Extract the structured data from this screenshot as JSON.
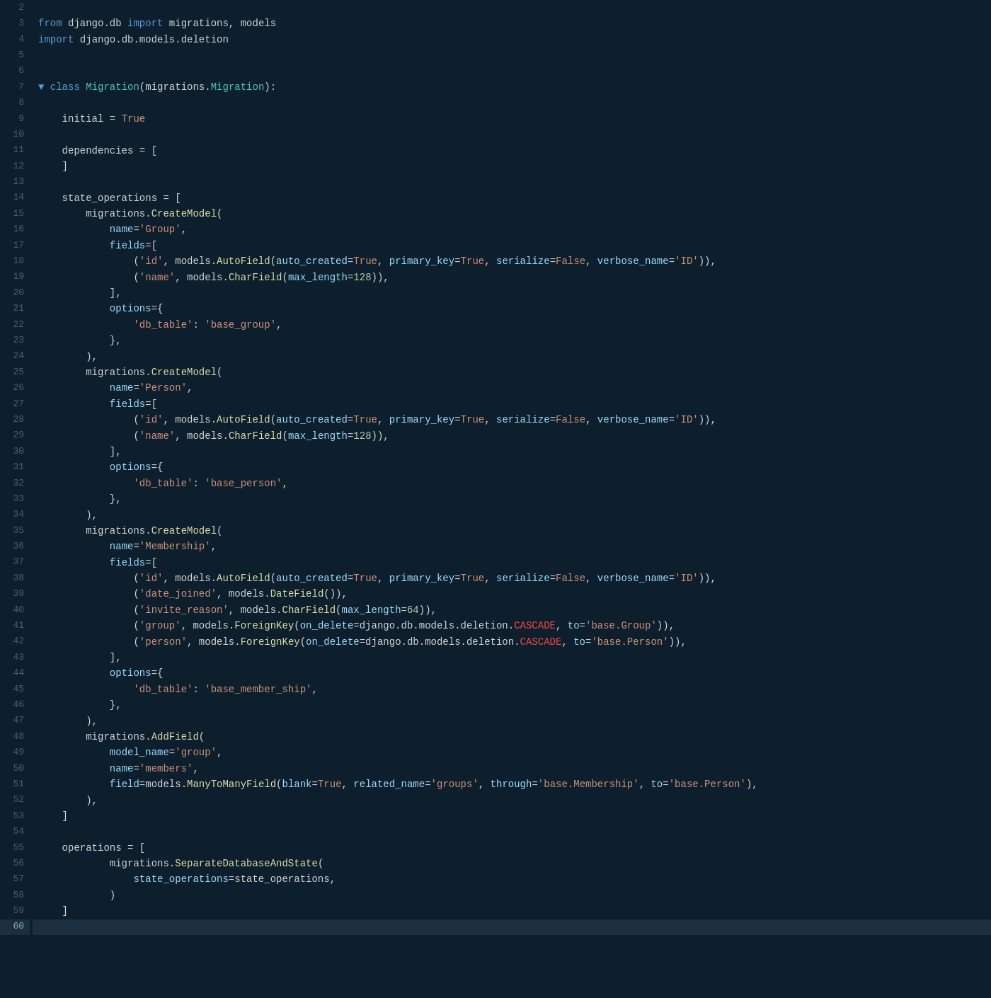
{
  "editor": {
    "background": "#0d1f2d",
    "active_line": 60
  },
  "lines": [
    {
      "num": 2,
      "content": "",
      "tokens": []
    },
    {
      "num": 3,
      "content": "from django.db import migrations, models",
      "active": false
    },
    {
      "num": 4,
      "content": "import django.db.models.deletion",
      "active": false
    },
    {
      "num": 5,
      "content": "",
      "tokens": []
    },
    {
      "num": 6,
      "content": "",
      "tokens": []
    },
    {
      "num": 7,
      "content": "▼ class Migration(migrations.Migration):",
      "active": false
    },
    {
      "num": 8,
      "content": "",
      "tokens": []
    },
    {
      "num": 9,
      "content": "    initial = True",
      "active": false
    },
    {
      "num": 10,
      "content": "",
      "tokens": []
    },
    {
      "num": 11,
      "content": "    dependencies = [",
      "active": false
    },
    {
      "num": 12,
      "content": "    ]",
      "active": false
    },
    {
      "num": 13,
      "content": "",
      "tokens": []
    },
    {
      "num": 14,
      "content": "    state_operations = [",
      "active": false
    },
    {
      "num": 15,
      "content": "        migrations.CreateModel(",
      "active": false
    },
    {
      "num": 16,
      "content": "            name='Group',",
      "active": false
    },
    {
      "num": 17,
      "content": "            fields=[",
      "active": false
    },
    {
      "num": 18,
      "content": "                ('id', models.AutoField(auto_created=True, primary_key=True, serialize=False, verbose_name='ID')),",
      "active": false
    },
    {
      "num": 19,
      "content": "                ('name', models.CharField(max_length=128)),",
      "active": false
    },
    {
      "num": 20,
      "content": "            ],",
      "active": false
    },
    {
      "num": 21,
      "content": "            options={",
      "active": false
    },
    {
      "num": 22,
      "content": "                'db_table': 'base_group',",
      "active": false
    },
    {
      "num": 23,
      "content": "            },",
      "active": false
    },
    {
      "num": 24,
      "content": "        ),",
      "active": false
    },
    {
      "num": 25,
      "content": "        migrations.CreateModel(",
      "active": false
    },
    {
      "num": 26,
      "content": "            name='Person',",
      "active": false
    },
    {
      "num": 27,
      "content": "            fields=[",
      "active": false
    },
    {
      "num": 28,
      "content": "                ('id', models.AutoField(auto_created=True, primary_key=True, serialize=False, verbose_name='ID')),",
      "active": false
    },
    {
      "num": 29,
      "content": "                ('name', models.CharField(max_length=128)),",
      "active": false
    },
    {
      "num": 30,
      "content": "            ],",
      "active": false
    },
    {
      "num": 31,
      "content": "            options={",
      "active": false
    },
    {
      "num": 32,
      "content": "                'db_table': 'base_person',",
      "active": false
    },
    {
      "num": 33,
      "content": "            },",
      "active": false
    },
    {
      "num": 34,
      "content": "        ),",
      "active": false
    },
    {
      "num": 35,
      "content": "        migrations.CreateModel(",
      "active": false
    },
    {
      "num": 36,
      "content": "            name='Membership',",
      "active": false
    },
    {
      "num": 37,
      "content": "            fields=[",
      "active": false
    },
    {
      "num": 38,
      "content": "                ('id', models.AutoField(auto_created=True, primary_key=True, serialize=False, verbose_name='ID')),",
      "active": false
    },
    {
      "num": 39,
      "content": "                ('date_joined', models.DateField()),",
      "active": false
    },
    {
      "num": 40,
      "content": "                ('invite_reason', models.CharField(max_length=64)),",
      "active": false
    },
    {
      "num": 41,
      "content": "                ('group', models.ForeignKey(on_delete=django.db.models.deletion.CASCADE, to='base.Group')),",
      "active": false
    },
    {
      "num": 42,
      "content": "                ('person', models.ForeignKey(on_delete=django.db.models.deletion.CASCADE, to='base.Person')),",
      "active": false
    },
    {
      "num": 43,
      "content": "            ],",
      "active": false
    },
    {
      "num": 44,
      "content": "            options={",
      "active": false
    },
    {
      "num": 45,
      "content": "                'db_table': 'base_member_ship',",
      "active": false
    },
    {
      "num": 46,
      "content": "            },",
      "active": false
    },
    {
      "num": 47,
      "content": "        ),",
      "active": false
    },
    {
      "num": 48,
      "content": "        migrations.AddField(",
      "active": false
    },
    {
      "num": 49,
      "content": "            model_name='group',",
      "active": false
    },
    {
      "num": 50,
      "content": "            name='members',",
      "active": false
    },
    {
      "num": 51,
      "content": "            field=models.ManyToManyField(blank=True, related_name='groups', through='base.Membership', to='base.Person'),",
      "active": false
    },
    {
      "num": 52,
      "content": "        ),",
      "active": false
    },
    {
      "num": 53,
      "content": "    ]",
      "active": false
    },
    {
      "num": 54,
      "content": "",
      "tokens": []
    },
    {
      "num": 55,
      "content": "    operations = [",
      "active": false
    },
    {
      "num": 56,
      "content": "            migrations.SeparateDatabaseAndState(",
      "active": false
    },
    {
      "num": 57,
      "content": "                state_operations=state_operations,",
      "active": false
    },
    {
      "num": 58,
      "content": "            )",
      "active": false
    },
    {
      "num": 59,
      "content": "    ]",
      "active": false
    },
    {
      "num": 60,
      "content": "",
      "active": true
    }
  ]
}
